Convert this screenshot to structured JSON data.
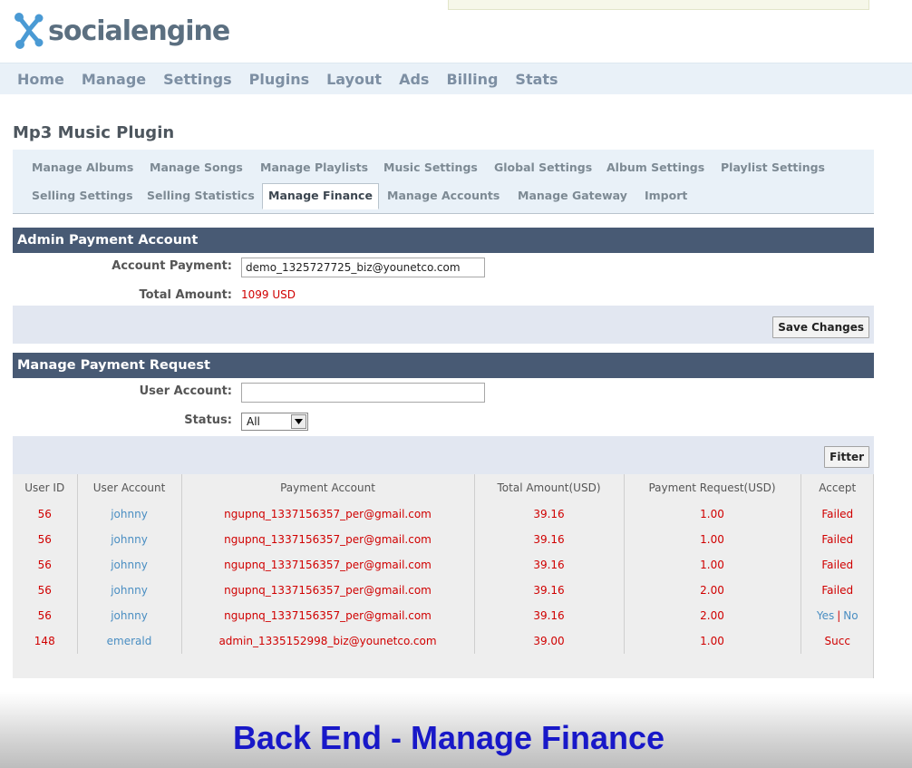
{
  "brand": {
    "logo_text": "socialengine"
  },
  "main_nav": [
    "Home",
    "Manage",
    "Settings",
    "Plugins",
    "Layout",
    "Ads",
    "Billing",
    "Stats"
  ],
  "page_title": "Mp3 Music Plugin",
  "tabs_row1": [
    "Manage Albums",
    "Manage Songs",
    "Manage Playlists",
    "Music Settings",
    "Global Settings",
    "Album Settings",
    "Playlist Settings"
  ],
  "tabs_row2": [
    "Selling Settings",
    "Selling Statistics",
    "Manage Finance",
    "Manage Accounts",
    "Manage Gateway",
    "Import"
  ],
  "active_tab": "Manage Finance",
  "admin_section": {
    "title": "Admin Payment Account",
    "account_label": "Account Payment:",
    "account_value": "demo_1325727725_biz@younetco.com",
    "total_label": "Total Amount:",
    "total_value": "1099 USD",
    "save_button": "Save Changes"
  },
  "request_section": {
    "title": "Manage Payment Request",
    "user_label": "User Account:",
    "user_value": "",
    "status_label": "Status:",
    "status_selected": "All",
    "filter_button": "Fitter"
  },
  "table": {
    "headers": [
      "User ID",
      "User Account",
      "Payment Account",
      "Total Amount(USD)",
      "Payment Request(USD)",
      "Accept"
    ],
    "rows": [
      {
        "id": "56",
        "user": "johnny",
        "payment": "ngupnq_1337156357_per@gmail.com",
        "total": "39.16",
        "request": "1.00",
        "accept": "Failed"
      },
      {
        "id": "56",
        "user": "johnny",
        "payment": "ngupnq_1337156357_per@gmail.com",
        "total": "39.16",
        "request": "1.00",
        "accept": "Failed"
      },
      {
        "id": "56",
        "user": "johnny",
        "payment": "ngupnq_1337156357_per@gmail.com",
        "total": "39.16",
        "request": "1.00",
        "accept": "Failed"
      },
      {
        "id": "56",
        "user": "johnny",
        "payment": "ngupnq_1337156357_per@gmail.com",
        "total": "39.16",
        "request": "2.00",
        "accept": "Failed"
      },
      {
        "id": "56",
        "user": "johnny",
        "payment": "ngupnq_1337156357_per@gmail.com",
        "total": "39.16",
        "request": "2.00",
        "accept": "",
        "accept_yes": "Yes",
        "accept_sep": "|",
        "accept_no": "No"
      },
      {
        "id": "148",
        "user": "emerald",
        "payment": "admin_1335152998_biz@younetco.com",
        "total": "39.00",
        "request": "1.00",
        "accept": "Succ"
      }
    ]
  },
  "banner_text": "Back End - Manage Finance",
  "colors": {
    "header_bar": "#485a74",
    "nav_bg": "#e9f1f8",
    "value_red": "#d00000",
    "link_blue": "#4a8ec2",
    "banner_text": "#1818c8"
  },
  "icons": {
    "logo": "socialengine-x-logo-icon",
    "select_arrow": "chevron-down-icon"
  }
}
